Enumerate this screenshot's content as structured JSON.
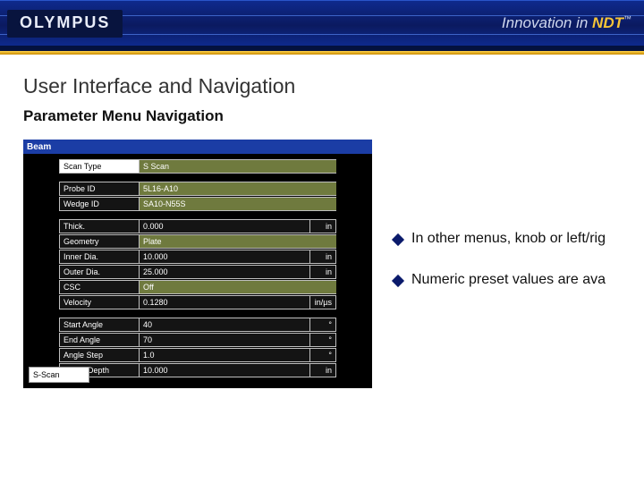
{
  "brand": {
    "logo": "OLYMPUS",
    "tagline_lead": "Innovation in ",
    "tagline_em": "NDT",
    "tagline_tm": "™"
  },
  "slide": {
    "title": "User Interface and Navigation",
    "subtitle": "Parameter Menu Navigation"
  },
  "panel": {
    "title": "Beam",
    "footer_button": "S-Scan",
    "groups": [
      [
        {
          "label": "Scan Type",
          "value": "S Scan",
          "unit": "",
          "selected": true,
          "green": true
        }
      ],
      [
        {
          "label": "Probe ID",
          "value": "5L16-A10",
          "unit": "",
          "green": true
        },
        {
          "label": "Wedge ID",
          "value": "SA10-N55S",
          "unit": "",
          "green": true
        }
      ],
      [
        {
          "label": "Thick.",
          "value": "0.000",
          "unit": "in"
        },
        {
          "label": "Geometry",
          "value": "Plate",
          "unit": "",
          "green": true
        },
        {
          "label": "Inner Dia.",
          "value": "10.000",
          "unit": "in"
        },
        {
          "label": "Outer Dia.",
          "value": "25.000",
          "unit": "in"
        },
        {
          "label": "CSC",
          "value": "Off",
          "unit": "",
          "green": true
        },
        {
          "label": "Velocity",
          "value": "0.1280",
          "unit": "in/µs"
        }
      ],
      [
        {
          "label": "Start Angle",
          "value": "40",
          "unit": "°"
        },
        {
          "label": "End Angle",
          "value": "70",
          "unit": "°"
        },
        {
          "label": "Angle Step",
          "value": "1.0",
          "unit": "°"
        },
        {
          "label": "Focus Depth",
          "value": "10.000",
          "unit": "in"
        }
      ]
    ]
  },
  "bullets": [
    "In other menus, knob or left/rig",
    "Numeric preset values are ava"
  ]
}
